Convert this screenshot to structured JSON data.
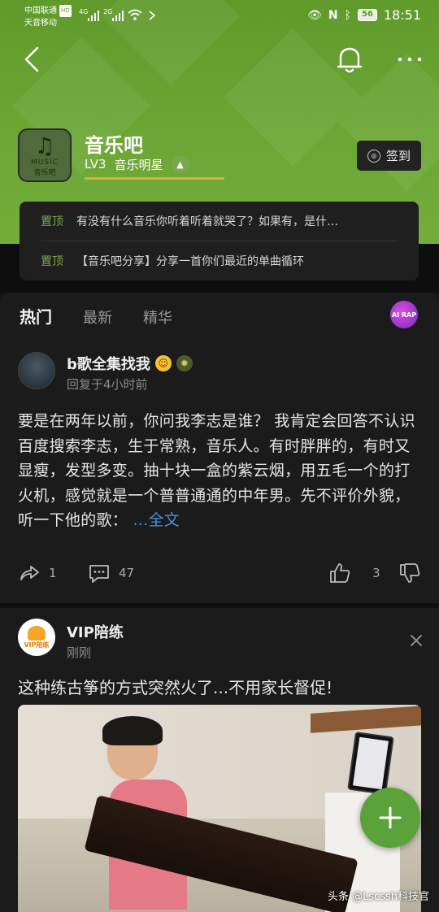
{
  "status_bar": {
    "carrier1": "中国联通",
    "carrier_badge": "HD",
    "carrier2": "天音移动",
    "network1": "4G",
    "network2": "2G",
    "battery": "56",
    "time": "18:51"
  },
  "forum": {
    "name": "音乐吧",
    "level": "LV3",
    "level_title": "音乐明星",
    "logo_text": "MUSIC",
    "logo_caption": "音乐吧",
    "signin_label": "签到"
  },
  "pinned": [
    {
      "tag": "置顶",
      "text": "有没有什么音乐你听着听着就哭了？如果有，是什…"
    },
    {
      "tag": "置顶",
      "text": "【音乐吧分享】分享一首你们最近的单曲循环"
    }
  ],
  "tabs": [
    {
      "label": "热门",
      "active": true
    },
    {
      "label": "最新",
      "active": false
    },
    {
      "label": "精华",
      "active": false
    }
  ],
  "tab_logo_text": "AI RAP",
  "post": {
    "username": "b歌全集找我",
    "time": "回复于4小时前",
    "body": "要是在两年以前，你问我李志是谁？ 我肯定会回答不认识 百度搜索李志，生于常熟，音乐人。有时胖胖的，有时又显瘦，发型多变。抽十块一盒的紫云烟，用五毛一个的打火机，感觉就是一个普普通通的中年男。先不评价外貌，听一下他的歌：",
    "more_label": "...全文",
    "share_count": "1",
    "comment_count": "47",
    "like_count": "3"
  },
  "ad": {
    "name": "VIP陪练",
    "logo_text": "VIP陪练",
    "time": "刚刚",
    "title": "这种练古筝的方式突然火了...不用家长督促!"
  },
  "watermark": "头条 @Lscssh科技官",
  "colors": {
    "header_green": "#6aa534",
    "accent_green": "#7aa84f",
    "link_blue": "#4a90e2",
    "fab_green": "#5aa23a"
  }
}
